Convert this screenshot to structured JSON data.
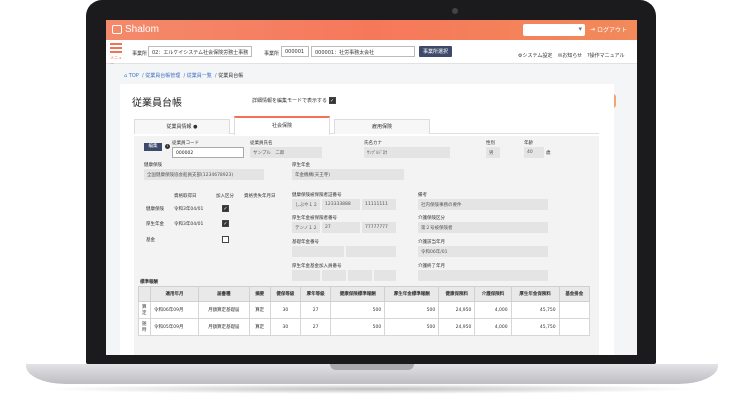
{
  "topbar": {
    "logo": "Shalom",
    "logout": "ログアウト"
  },
  "subhead": {
    "office_label": "事業所",
    "office_value": "02：エルケイシステム社会保険労務士事務",
    "worksite_label": "事業所",
    "worksite_code": "000001",
    "worksite_value": "000001：社労事務太会社",
    "change_button": "事業所選択",
    "menu_label": "メニュー",
    "links": [
      "システム設定",
      "お知らせ",
      "操作マニュアル"
    ]
  },
  "breadcrumb": {
    "items": [
      "TOP",
      "従業員台帳管理",
      "従業員一覧"
    ],
    "current": "従業員台帳"
  },
  "page": {
    "title": "従業員台帳",
    "detail_toggle": "詳細情報を編集モードで表示する"
  },
  "tabs": [
    "従業員情報",
    "社会保険",
    "雇用保険"
  ],
  "employee": {
    "edit_button": "編集",
    "code_label": "従業員コード",
    "code_value": "000002",
    "name_label": "従業員氏名",
    "name_value": "サンプル　二郎",
    "kana_label": "氏名カナ",
    "kana_value": "ｻﾝﾌﾟﾙｼﾞﾛｳ",
    "gender_label": "性別",
    "gender_value": "男",
    "age_label": "年齢",
    "age_value": "40",
    "age_unit": "歳"
  },
  "insurance": {
    "health_label": "健康保険",
    "health_value": "全国健康保険協会船員支部(1234678923)",
    "pension_label": "厚生年金",
    "pension_value": "年金機構(天王寺)"
  },
  "acquisition": {
    "headers": [
      "資格取得日",
      "加入区分",
      "資格喪失年月日"
    ],
    "rows": [
      {
        "label": "健康保険",
        "date": "令和3年04/01",
        "joined": true
      },
      {
        "label": "厚生年金",
        "date": "令和3年04/01",
        "joined": true
      },
      {
        "label": "基金",
        "date": "",
        "joined": false
      }
    ]
  },
  "numbers": {
    "health_card_label": "健康保険被保険者証番号",
    "health_card": [
      "しぶや１２",
      "123333888",
      "11111111"
    ],
    "pension_no_label": "厚生年金被保険者番号",
    "pension_no": [
      "テンノ１２",
      "27",
      "77777777"
    ],
    "basic_no_label": "基礎年金番号",
    "fund_no_label": "厚生年金基金加入員番号"
  },
  "right": {
    "remarks_label": "備考",
    "remarks_value": "社内保険事務の要件",
    "care_label": "介護保険区分",
    "care_value": "第２号被保険者",
    "care_start_label": "介護該当年月",
    "care_start_value": "令和06年/01",
    "care_end_label": "介護終了年月"
  },
  "standard_table": {
    "title": "標準報酬",
    "headers": [
      "適用年月",
      "届書種",
      "摘要",
      "健保等級",
      "厚年等級",
      "健康保険標準報酬",
      "厚生年金標準報酬",
      "健康保険料",
      "介護保険料",
      "厚生年金保険料",
      "基金掛金"
    ],
    "rows": [
      [
        "算定",
        "令和06年09月",
        "月額算定基礎届",
        "算定",
        "30",
        "27",
        "500",
        "500",
        "24,950",
        "4,000",
        "45,750",
        ""
      ],
      [
        "随時",
        "令和05年09月",
        "月額算定基礎届",
        "算定",
        "30",
        "27",
        "500",
        "500",
        "24,950",
        "4,000",
        "45,750",
        ""
      ]
    ]
  },
  "colors": {
    "accent": "#f27258",
    "navy": "#3d4a6b"
  }
}
